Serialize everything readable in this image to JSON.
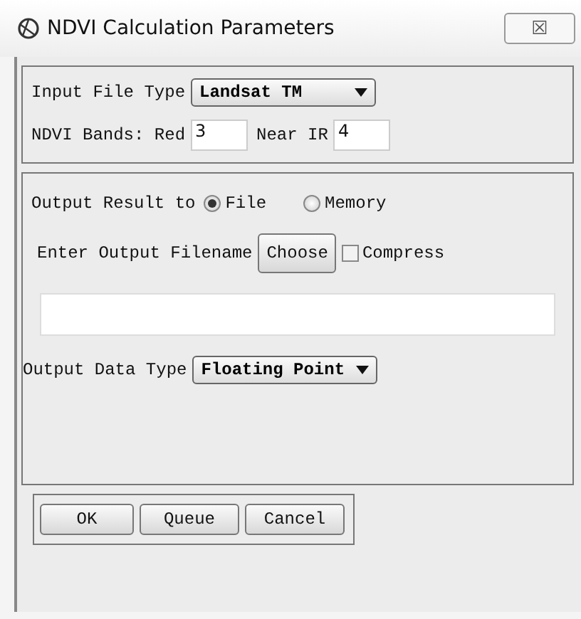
{
  "window": {
    "title": "NDVI Calculation Parameters",
    "close": "☒"
  },
  "input_file_type": {
    "label": "Input File Type",
    "value": "Landsat TM"
  },
  "ndvi_bands": {
    "label": "NDVI Bands: Red",
    "red": "3",
    "near_ir_label": "Near IR",
    "near_ir": "4"
  },
  "output_result": {
    "label": "Output Result to",
    "options": [
      {
        "label": "File",
        "selected": true
      },
      {
        "label": "Memory",
        "selected": false
      }
    ]
  },
  "output_filename": {
    "label": "Enter Output Filename",
    "choose": "Choose",
    "compress": {
      "label": "Compress",
      "checked": false
    }
  },
  "output_data_type": {
    "label": "Output Data Type",
    "value": "Floating Point"
  },
  "buttons": [
    "OK",
    "Queue",
    "Cancel"
  ]
}
